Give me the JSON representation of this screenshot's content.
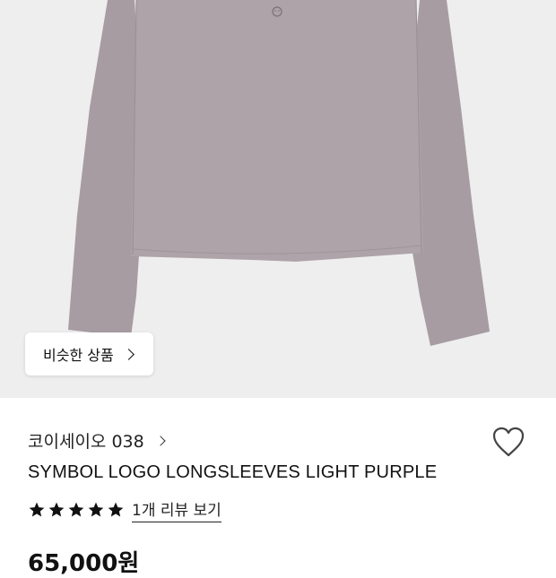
{
  "similar_button": {
    "label": "비슷한 상품"
  },
  "product": {
    "brand": "코이세이오 038",
    "name": "SYMBOL LOGO LONGSLEEVES LIGHT PURPLE",
    "rating": 5,
    "review_link": "1개 리뷰 보기",
    "price": "65,000원"
  },
  "colors": {
    "hero_background": "#efeeef",
    "garment": "#aea3a8",
    "text": "#111111"
  },
  "icons": {
    "heart": "heart-outline-icon",
    "star": "star-filled-icon",
    "chevron": "chevron-right-icon"
  }
}
